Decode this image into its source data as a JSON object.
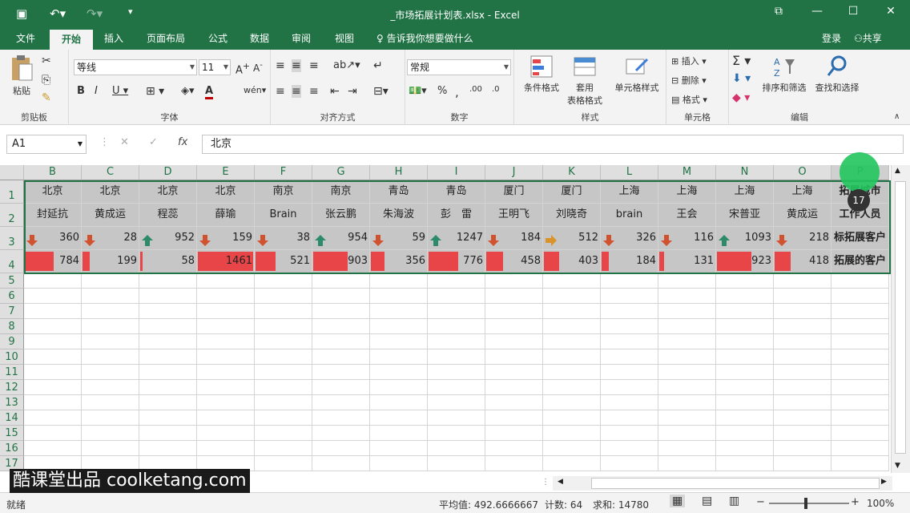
{
  "window": {
    "title": "_市场拓展计划表.xlsx - Excel"
  },
  "tabs": [
    "文件",
    "开始",
    "插入",
    "页面布局",
    "公式",
    "数据",
    "审阅",
    "视图"
  ],
  "tell_me": "告诉我你想要做什么",
  "login": "登录",
  "share": "共享",
  "ribbon": {
    "clipboard": {
      "label": "剪贴板",
      "paste": "粘贴"
    },
    "font": {
      "label": "字体",
      "name": "等线",
      "size": "11"
    },
    "align": {
      "label": "对齐方式"
    },
    "number": {
      "label": "数字",
      "format": "常规"
    },
    "styles": {
      "label": "样式",
      "cond": "条件格式",
      "table1": "套用",
      "table2": "表格格式",
      "cell": "单元格样式"
    },
    "cells": {
      "label": "单元格",
      "insert": "插入",
      "delete": "删除",
      "format": "格式"
    },
    "editing": {
      "label": "编辑",
      "sort": "排序和筛选",
      "find": "查找和选择"
    }
  },
  "formula_bar": {
    "name_box": "A1",
    "formula": "北京"
  },
  "columns": [
    "B",
    "C",
    "D",
    "E",
    "F",
    "G",
    "H",
    "I",
    "J",
    "K",
    "L",
    "M",
    "N",
    "O",
    "P"
  ],
  "rows": [
    "1",
    "2",
    "3",
    "4",
    "5",
    "6",
    "7",
    "8",
    "9",
    "10",
    "11",
    "12",
    "13",
    "14",
    "15",
    "16",
    "17"
  ],
  "row1": [
    "北京",
    "北京",
    "北京",
    "北京",
    "南京",
    "南京",
    "青岛",
    "青岛",
    "厦门",
    "厦门",
    "上海",
    "上海",
    "上海",
    "上海",
    "拓展城市"
  ],
  "row2": [
    "封延抗",
    "黄成运",
    "程蕊",
    "薛瑜",
    "Brain",
    "张云鹏",
    "朱海波",
    "彭　雷",
    "王明飞",
    "刘晓奇",
    "brain",
    "王会",
    "宋普亚",
    "黄成运",
    "工作人员"
  ],
  "row3": [
    "360",
    "28",
    "952",
    "159",
    "38",
    "954",
    "59",
    "1247",
    "184",
    "512",
    "326",
    "116",
    "1093",
    "218",
    "标拓展客户"
  ],
  "row3_icons": [
    "down",
    "down",
    "up",
    "down",
    "down",
    "up",
    "down",
    "up",
    "down",
    "right",
    "down",
    "down",
    "up",
    "down",
    ""
  ],
  "row4": [
    "784",
    "199",
    "58",
    "1461",
    "521",
    "903",
    "356",
    "776",
    "458",
    "403",
    "184",
    "131",
    "923",
    "418",
    "拓展的客户"
  ],
  "row4_bars": [
    0.52,
    0.13,
    0.04,
    1.0,
    0.36,
    0.62,
    0.24,
    0.53,
    0.31,
    0.28,
    0.13,
    0.09,
    0.63,
    0.29,
    0
  ],
  "status": {
    "ready": "就绪",
    "avg": "平均值: 492.6666667",
    "count": "计数: 64",
    "sum": "求和: 14780",
    "zoom": "100%"
  },
  "watermark": "酷课堂出品 coolketang.com",
  "cursor_badge": "17",
  "colors": {
    "accent": "#217346",
    "bar": "#e84549",
    "up": "#2e8b6a",
    "down": "#d0522e",
    "side": "#d9932a"
  }
}
